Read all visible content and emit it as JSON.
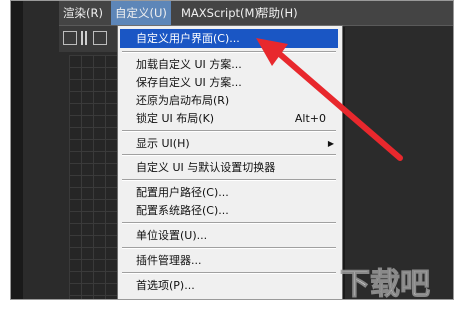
{
  "menubar": {
    "items": [
      "渲染(R)",
      "自定义(U)",
      "MAXScript(M)",
      "帮助(H)"
    ]
  },
  "dropdown": {
    "items": [
      {
        "label": "自定义用户界面(C)..."
      },
      {
        "label": "加载自定义 UI 方案..."
      },
      {
        "label": "保存自定义 UI 方案..."
      },
      {
        "label": "还原为启动布局(R)"
      },
      {
        "label": "锁定 UI 布局(K)",
        "shortcut": "Alt+0"
      },
      {
        "label": "显示 UI(H)"
      },
      {
        "label": "自定义 UI 与默认设置切换器"
      },
      {
        "label": "配置用户路径(C)..."
      },
      {
        "label": "配置系统路径(C)..."
      },
      {
        "label": "单位设置(U)..."
      },
      {
        "label": "插件管理器..."
      },
      {
        "label": "首选项(P)..."
      }
    ]
  },
  "watermark": {
    "text": "下载吧"
  },
  "colors": {
    "highlight": "#1a56c4",
    "active_menu": "#5d86b8",
    "arrow": "#e8282d"
  }
}
